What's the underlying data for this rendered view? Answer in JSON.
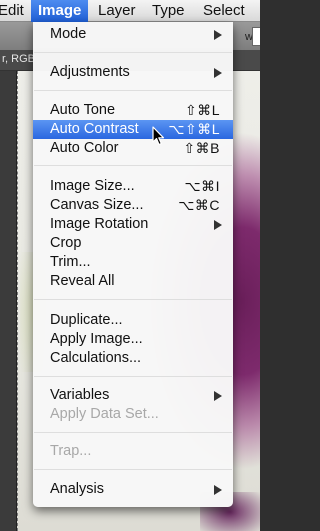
{
  "menubar": {
    "items": [
      {
        "label": "Edit"
      },
      {
        "label": "Image"
      },
      {
        "label": "Layer"
      },
      {
        "label": "Type"
      },
      {
        "label": "Select"
      }
    ]
  },
  "background": {
    "doc_tab_label": "r, RGB",
    "options_field_label": "w:"
  },
  "menu": {
    "items": [
      {
        "label": "Mode",
        "submenu": true
      },
      {
        "label": "Adjustments",
        "submenu": true
      },
      {
        "label": "Auto Tone",
        "shortcut": "⇧⌘L"
      },
      {
        "label": "Auto Contrast",
        "shortcut": "⌥⇧⌘L",
        "highlighted": true
      },
      {
        "label": "Auto Color",
        "shortcut": "⇧⌘B"
      },
      {
        "label": "Image Size...",
        "shortcut": "⌥⌘I"
      },
      {
        "label": "Canvas Size...",
        "shortcut": "⌥⌘C"
      },
      {
        "label": "Image Rotation",
        "submenu": true
      },
      {
        "label": "Crop"
      },
      {
        "label": "Trim..."
      },
      {
        "label": "Reveal All"
      },
      {
        "label": "Duplicate..."
      },
      {
        "label": "Apply Image..."
      },
      {
        "label": "Calculations..."
      },
      {
        "label": "Variables",
        "submenu": true
      },
      {
        "label": "Apply Data Set...",
        "disabled": true
      },
      {
        "label": "Trap...",
        "disabled": true
      },
      {
        "label": "Analysis",
        "submenu": true
      }
    ]
  },
  "colors": {
    "menubar_active": "#2a67e0",
    "menu_highlight": "#3a78ea",
    "disabled_text": "#a8a8a8"
  }
}
